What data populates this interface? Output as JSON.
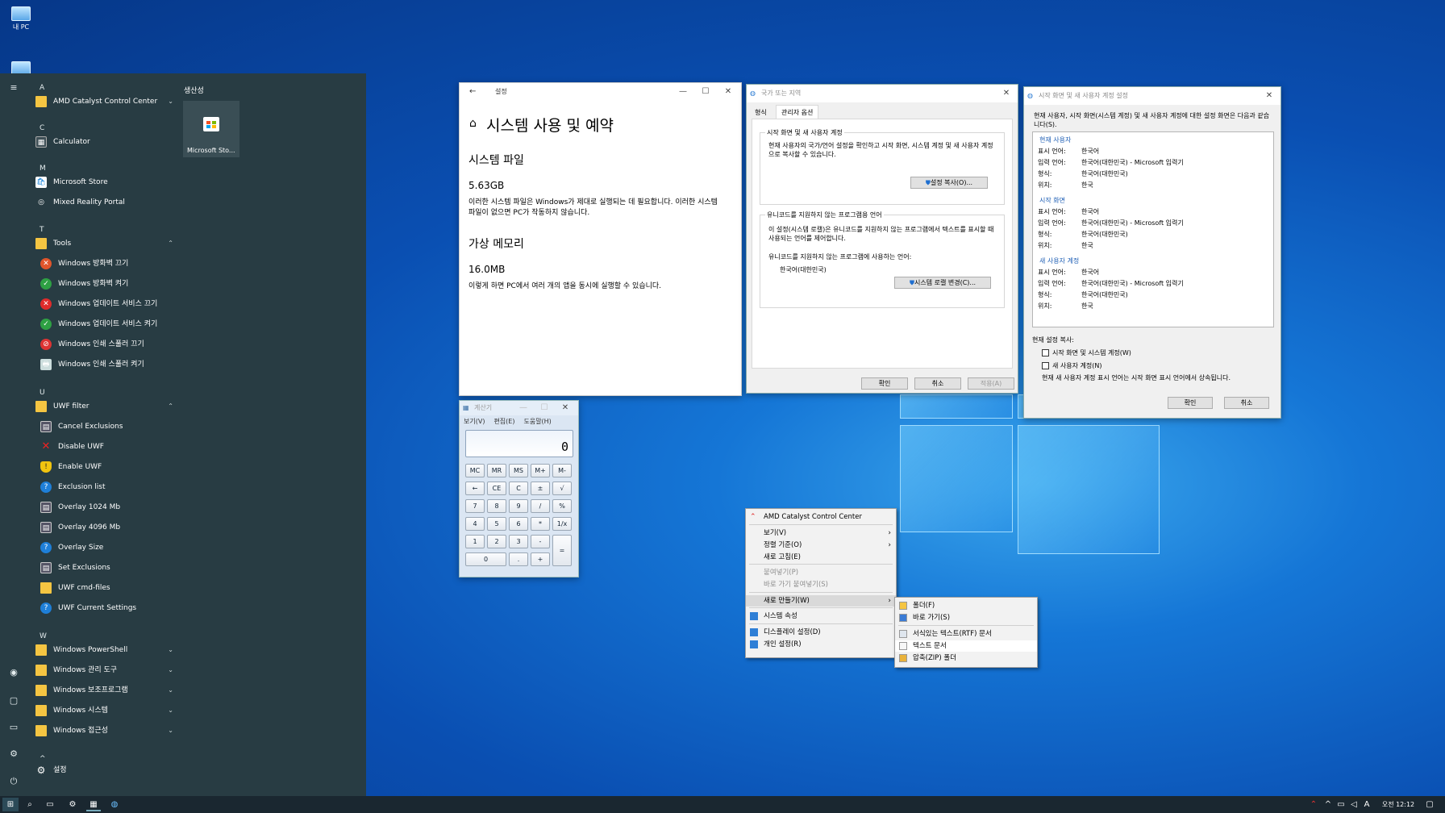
{
  "desktop": {
    "icons": [
      {
        "label": "내 PC"
      },
      {
        "label": ""
      }
    ]
  },
  "start_menu": {
    "pinned_header": "생산성",
    "tile_label": "Microsoft Sto...",
    "letters": [
      "A",
      "C",
      "M",
      "T",
      "U",
      "W"
    ],
    "items": [
      {
        "label": "AMD Catalyst Control Center",
        "chevron": "⌄"
      },
      {
        "label": "Calculator"
      },
      {
        "label": "Microsoft Store"
      },
      {
        "label": "Mixed Reality Portal"
      },
      {
        "label": "Tools",
        "chevron": "⌃"
      },
      {
        "label": "Windows 방화벽 끄기"
      },
      {
        "label": "Windows 방화벽 켜기"
      },
      {
        "label": "Windows 업데이트 서비스 끄기"
      },
      {
        "label": "Windows 업데이트 서비스 켜기"
      },
      {
        "label": "Windows 인쇄 스풀러 끄기"
      },
      {
        "label": "Windows 인쇄 스풀러 켜기"
      },
      {
        "label": "UWF filter",
        "chevron": "⌃"
      },
      {
        "label": "Cancel Exclusions"
      },
      {
        "label": "Disable UWF"
      },
      {
        "label": "Enable UWF"
      },
      {
        "label": "Exclusion list"
      },
      {
        "label": "Overlay 1024 Mb"
      },
      {
        "label": "Overlay 4096 Mb"
      },
      {
        "label": "Overlay Size"
      },
      {
        "label": "Set Exclusions"
      },
      {
        "label": "UWF cmd-files"
      },
      {
        "label": "UWF Current Settings"
      },
      {
        "label": "Windows PowerShell",
        "chevron": "⌄"
      },
      {
        "label": "Windows 관리 도구",
        "chevron": "⌄"
      },
      {
        "label": "Windows 보조프로그램",
        "chevron": "⌄"
      },
      {
        "label": "Windows 시스템",
        "chevron": "⌄"
      },
      {
        "label": "Windows 접근성",
        "chevron": "⌄"
      }
    ],
    "collapse_marker": "^",
    "settings_label": "설정"
  },
  "settings_window": {
    "title": "설정",
    "heading": "시스템 사용 및 예약",
    "section1_title": "시스템 파일",
    "section1_value": "5.63GB",
    "section1_desc": "이러한 시스템 파일은 Windows가 제대로 실행되는 데 필요합니다. 이러한 시스템 파일이 없으면 PC가 작동하지 않습니다.",
    "section2_title": "가상 메모리",
    "section2_value": "16.0MB",
    "section2_desc": "이렇게 하면 PC에서 여러 개의 앱을 동시에 실행할 수 있습니다."
  },
  "region_window": {
    "title": "국가 또는 지역",
    "tabs": [
      "형식",
      "관리자 옵션"
    ],
    "group1_title": "시작 화면 및 새 사용자 계정",
    "group1_text": "현재 사용자의 국가/언어 설정을 확인하고 시작 화면, 시스템 계정 및 새 사용자 계정으로 복사할 수 있습니다.",
    "copy_button": "설정 복사(O)...",
    "group2_title": "유니코드를 지원하지 않는 프로그램용 언어",
    "group2_text": "이 설정(시스템 로캘)은 유니코드를 지원하지 않는 프로그램에서 텍스트를 표시할 때 사용되는 언어를 제어합니다.",
    "current_lang_label": "유니코드를 지원하지 않는 프로그램에 사용하는 언어:",
    "current_lang_value": "한국어(대한민국)",
    "locale_button": "시스템 로캘 변경(C)...",
    "ok": "확인",
    "cancel": "취소",
    "apply": "적용(A)"
  },
  "welcome_window": {
    "title": "시작 화면 및 새 사용자 계정 설정",
    "intro": "현재 사용자, 시작 화면(시스템 계정) 및 새 사용자 계정에 대한 설정 화면은 다음과 같습니다(S).",
    "sections": [
      {
        "header": "현재 사용자",
        "rows": [
          [
            "표시 언어:",
            "한국어"
          ],
          [
            "입력 언어:",
            "한국어(대한민국) - Microsoft 입력기"
          ],
          [
            "형식:",
            "한국어(대한민국)"
          ],
          [
            "위치:",
            "한국"
          ]
        ]
      },
      {
        "header": "시작 화면",
        "rows": [
          [
            "표시 언어:",
            "한국어"
          ],
          [
            "입력 언어:",
            "한국어(대한민국) - Microsoft 입력기"
          ],
          [
            "형식:",
            "한국어(대한민국)"
          ],
          [
            "위치:",
            "한국"
          ]
        ]
      },
      {
        "header": "새 사용자 계정",
        "rows": [
          [
            "표시 언어:",
            "한국어"
          ],
          [
            "입력 언어:",
            "한국어(대한민국) - Microsoft 입력기"
          ],
          [
            "형식:",
            "한국어(대한민국)"
          ],
          [
            "위치:",
            "한국"
          ]
        ]
      }
    ],
    "copy_label": "현재 설정 복사:",
    "check1": "시작 화면 및 시스템 계정(W)",
    "check2": "새 사용자 계정(N)",
    "note": "현재 새 사용자 계정 표시 언어는 시작 화면 표시 언어에서 상속됩니다.",
    "ok": "확인",
    "cancel": "취소"
  },
  "calculator": {
    "title": "계산기",
    "menu": [
      "보기(V)",
      "편집(E)",
      "도움말(H)"
    ],
    "display": "0",
    "keys": [
      [
        "MC",
        "MR",
        "MS",
        "M+",
        "M-"
      ],
      [
        "←",
        "CE",
        "C",
        "±",
        "√"
      ],
      [
        "7",
        "8",
        "9",
        "/",
        "%"
      ],
      [
        "4",
        "5",
        "6",
        "*",
        "1/x"
      ],
      [
        "1",
        "2",
        "3",
        "-",
        "="
      ],
      [
        "0",
        ".",
        "+"
      ]
    ]
  },
  "context_menu": {
    "items": [
      {
        "label": "AMD Catalyst Control Center"
      },
      {
        "label": "보기(V)",
        "arrow": "›"
      },
      {
        "label": "정렬 기준(O)",
        "arrow": "›"
      },
      {
        "label": "새로 고침(E)"
      },
      {
        "label": "붙여넣기(P)",
        "disabled": true
      },
      {
        "label": "바로 가기 붙여넣기(S)",
        "disabled": true
      },
      {
        "label": "새로 만들기(W)",
        "arrow": "›"
      },
      {
        "label": "시스템 속성"
      },
      {
        "label": "디스플레이 설정(D)"
      },
      {
        "label": "개인 설정(R)"
      }
    ],
    "submenu": [
      {
        "label": "폴더(F)"
      },
      {
        "label": "바로 가기(S)"
      },
      {
        "label": "서식있는 텍스트(RTF) 문서"
      },
      {
        "label": "텍스트 문서"
      },
      {
        "label": "압축(ZIP) 폴더"
      }
    ]
  },
  "taskbar": {
    "tray_lang": "A",
    "clock": "오전 12:12"
  },
  "colors": {
    "start_bg": "#283c43",
    "accent": "#0078d7",
    "taskbar_bg": "#1a2730"
  }
}
